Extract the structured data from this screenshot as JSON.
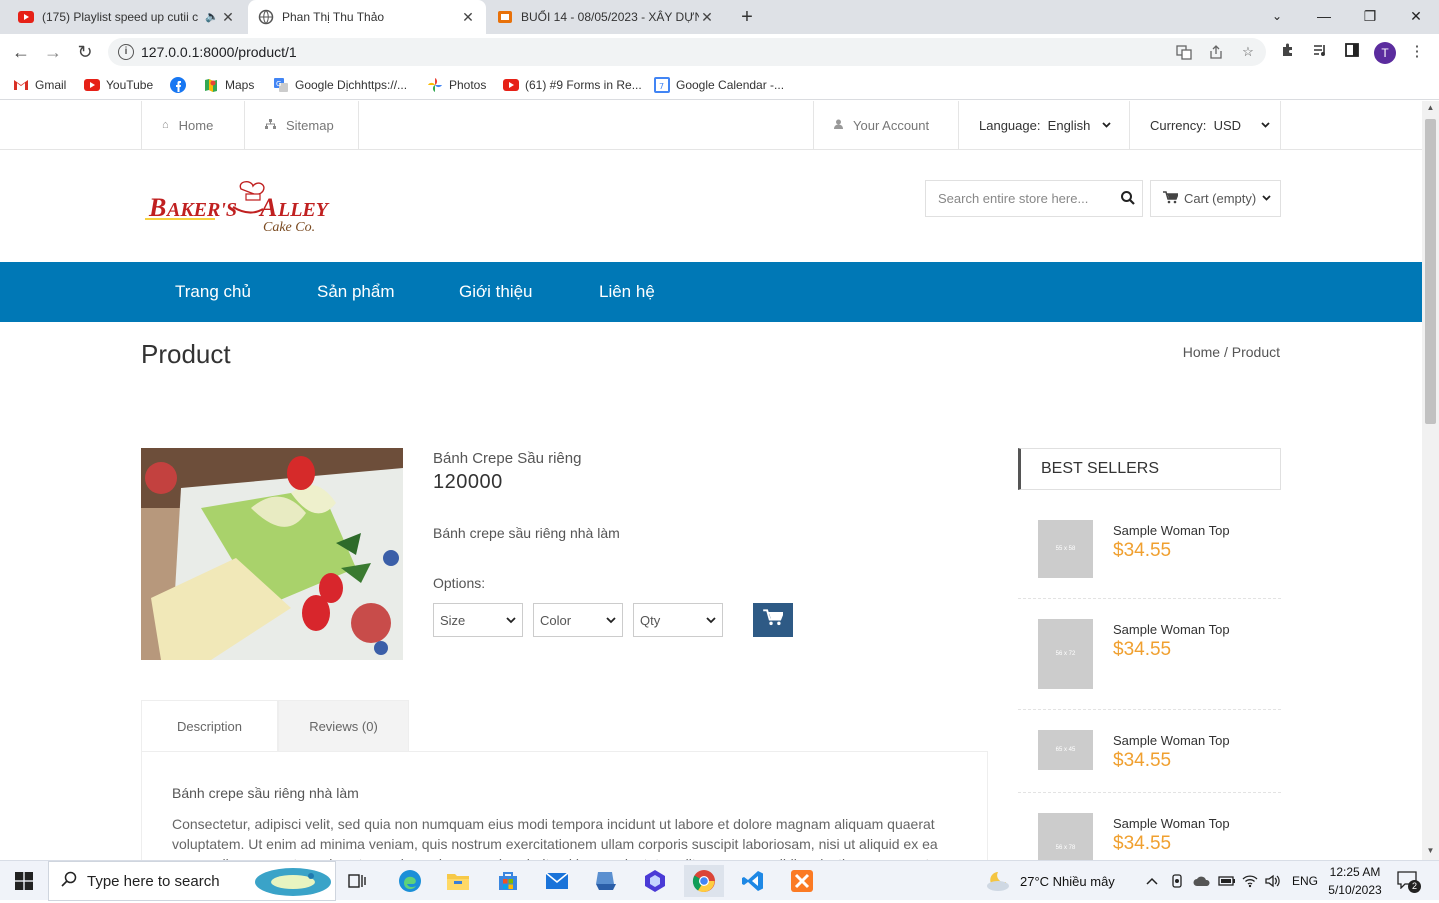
{
  "browser": {
    "tabs": [
      {
        "title": "(175) Playlist speed up cutii c",
        "icon": "youtube-icon"
      },
      {
        "title": "Phan Thị Thu Thảo",
        "icon": "globe-icon"
      },
      {
        "title": "BUỔI 14 - 08/05/2023 - XÂY DỰN",
        "icon": "slides-icon"
      }
    ],
    "url": "127.0.0.1:8000/product/1",
    "profile_initial": "T",
    "bookmarks": [
      {
        "label": "Gmail",
        "icon": "gmail-icon"
      },
      {
        "label": "YouTube",
        "icon": "youtube-icon"
      },
      {
        "label": "",
        "icon": "facebook-icon"
      },
      {
        "label": "Maps",
        "icon": "maps-icon"
      },
      {
        "label": "Google Dịchhttps://...",
        "icon": "translate-icon"
      },
      {
        "label": "Photos",
        "icon": "photos-icon"
      },
      {
        "label": "(61) #9 Forms in Re...",
        "icon": "youtube-icon"
      },
      {
        "label": "Google Calendar -...",
        "icon": "calendar-icon"
      }
    ]
  },
  "topbar": {
    "home": "Home",
    "sitemap": "Sitemap",
    "account": "Your Account",
    "language": "Language:  English",
    "currency": "Currency:  USD"
  },
  "header": {
    "search_placeholder": "Search entire store here...",
    "cart": "Cart (empty)"
  },
  "nav": [
    "Trang chủ",
    "Sản phẩm",
    "Giới thiệu",
    "Liên hệ"
  ],
  "page": {
    "title": "Product",
    "breadcrumb": "Home / Product"
  },
  "product": {
    "name": "Bánh Crepe Sầu riêng",
    "price": "120000",
    "short_desc": "Bánh crepe sầu riêng nhà làm",
    "options_label": "Options:",
    "options": [
      "Size",
      "Color",
      "Qty"
    ]
  },
  "tabs": {
    "description": "Description",
    "reviews": "Reviews (0)",
    "desc_title": "Bánh crepe sầu riêng nhà làm",
    "desc_body": "Consectetur, adipisci velit, sed quia non numquam eius modi tempora incidunt ut labore et dolore magnam aliquam quaerat voluptatem. Ut enim ad minima veniam, quis nostrum exercitationem ullam corporis suscipit laboriosam, nisi ut aliquid ex ea commodi consequatur quis autem vel eum iure reprehenderit qui in ea voluptate velit esse quam nihil molestiae consequatur"
  },
  "best_sellers": {
    "heading": "BEST SELLERS",
    "items": [
      {
        "name": "Sample Woman Top",
        "price": "$34.55",
        "thumb": "55 x 58"
      },
      {
        "name": "Sample Woman Top",
        "price": "$34.55",
        "thumb": "56 x 72"
      },
      {
        "name": "Sample Woman Top",
        "price": "$34.55",
        "thumb": "65 x 45"
      },
      {
        "name": "Sample Woman Top",
        "price": "$34.55",
        "thumb": "56 x 78"
      }
    ]
  },
  "taskbar": {
    "search_placeholder": "Type here to search",
    "weather": "27°C  Nhiều mây",
    "lang": "ENG",
    "time": "12:25 AM",
    "date": "5/10/2023",
    "notif_count": "2"
  },
  "colors": {
    "nav_bg": "#0078b6",
    "price_accent": "#f0a030",
    "cart_button": "#2e5a85"
  }
}
